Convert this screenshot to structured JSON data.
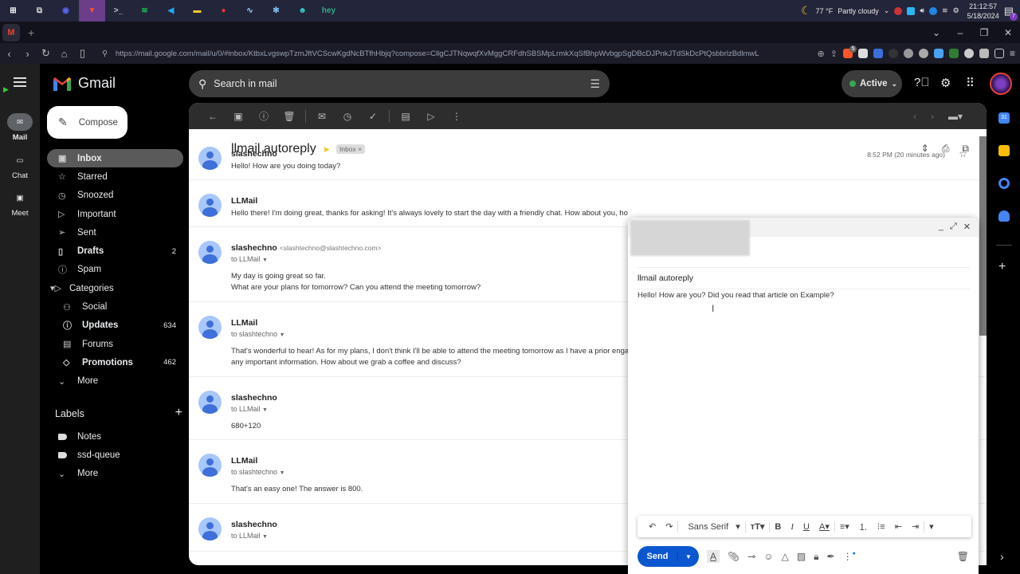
{
  "os": {
    "taskbar_apps": [
      {
        "name": "start",
        "glyph": "⊞",
        "color": "#ffffff"
      },
      {
        "name": "task-view",
        "glyph": "⧉",
        "color": "#cccccc"
      },
      {
        "name": "discord",
        "glyph": "◉",
        "color": "#5865f2"
      },
      {
        "name": "brave",
        "glyph": "▼",
        "color": "#fb542b",
        "active": true
      },
      {
        "name": "terminal",
        "glyph": ">_",
        "color": "#cccccc"
      },
      {
        "name": "spotify",
        "glyph": "≋",
        "color": "#1db954"
      },
      {
        "name": "vscode",
        "glyph": "◀",
        "color": "#23a8f2"
      },
      {
        "name": "file-explorer",
        "glyph": "▬",
        "color": "#f8c630"
      },
      {
        "name": "obs",
        "glyph": "●",
        "color": "#e33"
      },
      {
        "name": "monitor",
        "glyph": "∿",
        "color": "#9cf"
      },
      {
        "name": "app-snowflake",
        "glyph": "✻",
        "color": "#8cf"
      },
      {
        "name": "app-robot",
        "glyph": "☻",
        "color": "#3cc"
      },
      {
        "name": "hey-note",
        "glyph": "hey",
        "color": "#3a8"
      }
    ],
    "weather": {
      "temp": "77 °F",
      "condition": "Partly cloudy"
    },
    "clock": {
      "time": "21:12:57",
      "date": "5/18/2024"
    },
    "notification_count": "7"
  },
  "browser": {
    "tab_favicon": "M",
    "url": "https://mail.google.com/mail/u/0/#inbox/KtbxLvgswpTzmJftVCScwKgdNcBTfhHbjq?compose=CllgCJTNqwqfXvMggCRFdhSBSMpLrmkXqSfBhpWvbgpSgDBcDJPnkJTdSkDcPtQsbbrlzBdlmwL",
    "brave_shield_count": "5"
  },
  "rail": {
    "items": [
      {
        "label": "Mail",
        "active": true
      },
      {
        "label": "Chat"
      },
      {
        "label": "Meet"
      }
    ]
  },
  "header": {
    "app_name": "Gmail",
    "search_placeholder": "Search in mail",
    "status": "Active"
  },
  "compose_button": "Compose",
  "nav": [
    {
      "label": "Inbox",
      "icon": "inbox",
      "active": true
    },
    {
      "label": "Starred",
      "icon": "star"
    },
    {
      "label": "Snoozed",
      "icon": "clock"
    },
    {
      "label": "Important",
      "icon": "important"
    },
    {
      "label": "Sent",
      "icon": "send"
    },
    {
      "label": "Drafts",
      "icon": "draft",
      "count": "2",
      "bold": true
    },
    {
      "label": "Spam",
      "icon": "spam"
    },
    {
      "label": "Categories",
      "icon": "label"
    },
    {
      "label": "Social",
      "icon": "people",
      "sub": true
    },
    {
      "label": "Updates",
      "icon": "info",
      "sub": true,
      "count": "634",
      "bold": true
    },
    {
      "label": "Forums",
      "icon": "forum",
      "sub": true
    },
    {
      "label": "Promotions",
      "icon": "tag",
      "sub": true,
      "count": "462",
      "bold": true
    },
    {
      "label": "More",
      "icon": "chevron-down"
    }
  ],
  "labels": {
    "title": "Labels",
    "items": [
      "Notes",
      "ssd-queue"
    ],
    "more": "More"
  },
  "thread": {
    "subject": "llmail autoreply",
    "chip": "Inbox",
    "messages": [
      {
        "sender": "slashechno",
        "time": "8:52 PM (20 minutes ago)",
        "snippet": "Hello! How are you doing today?"
      },
      {
        "sender": "LLMail",
        "snippet": "Hello there! I'm doing great, thanks for asking! It's always lovely to start the day with a friendly chat. How about you, ho"
      },
      {
        "sender": "slashechno",
        "email": "<slashtechno@slashtechno.com>",
        "to": "to LLMail",
        "body": [
          "My day is going great so far.",
          "What are your plans for tomorrow? Can you attend the meeting tomorrow?"
        ]
      },
      {
        "sender": "LLMail",
        "to": "to slashtechno",
        "body": [
          "That's wonderful to hear! As for my plans, I don't think I'll be able to attend the meeting tomorrow as I have a prior enga",
          "any important information. How about we grab a coffee and discuss?"
        ]
      },
      {
        "sender": "slashechno",
        "to": "to LLMail",
        "body": [
          "680+120"
        ]
      },
      {
        "sender": "LLMail",
        "to": "to slashtechno",
        "body": [
          "That's an easy one! The answer is 800."
        ]
      },
      {
        "sender": "slashechno",
        "to": "to LLMail"
      }
    ]
  },
  "composer": {
    "subject": "llmail autoreply",
    "body": "Hello! How are you? Did you read that article on Example?",
    "font": "Sans Serif",
    "send_label": "Send"
  }
}
